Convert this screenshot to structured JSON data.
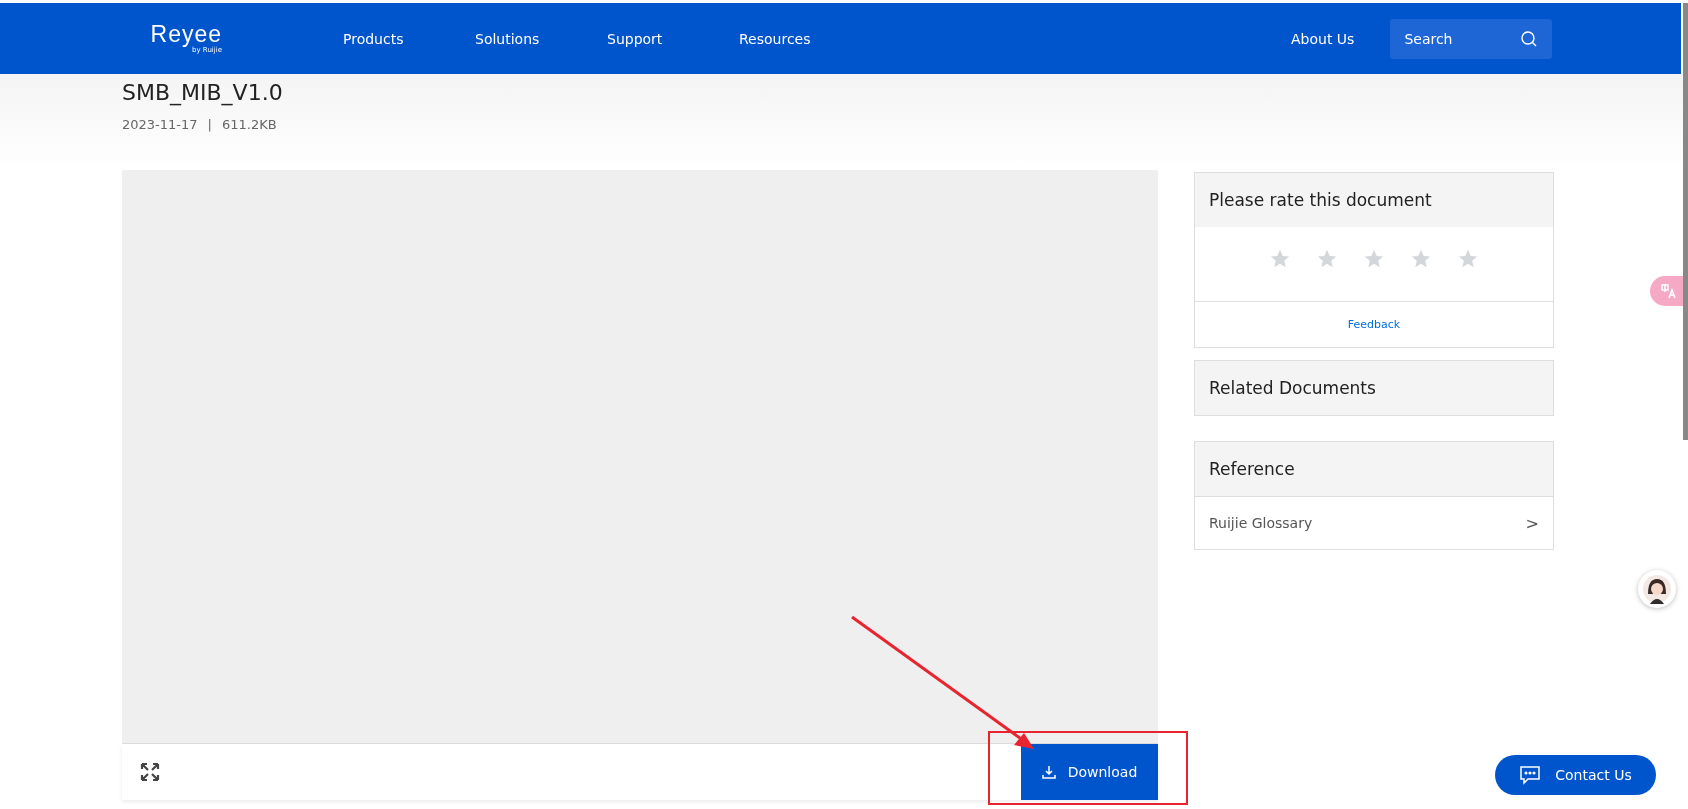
{
  "header": {
    "logo": {
      "wordmark": "Reyee",
      "tagline": "by Ruijie"
    },
    "nav": [
      {
        "label": "Products"
      },
      {
        "label": "Solutions"
      },
      {
        "label": "Support"
      },
      {
        "label": "Resources"
      }
    ],
    "about": "About Us",
    "search": {
      "placeholder": "Search"
    }
  },
  "document": {
    "title": "SMB_MIB_V1.0",
    "date": "2023-11-17",
    "separator": "|",
    "size": "611.2KB"
  },
  "viewer": {
    "download": "Download"
  },
  "rating": {
    "title": "Please rate this document",
    "stars": 0,
    "feedback": "Feedback"
  },
  "related": {
    "title": "Related Documents"
  },
  "reference": {
    "title": "Reference",
    "items": [
      {
        "label": "Ruijie Glossary",
        "chevron": ">"
      }
    ]
  },
  "contact": {
    "label": "Contact Us"
  }
}
